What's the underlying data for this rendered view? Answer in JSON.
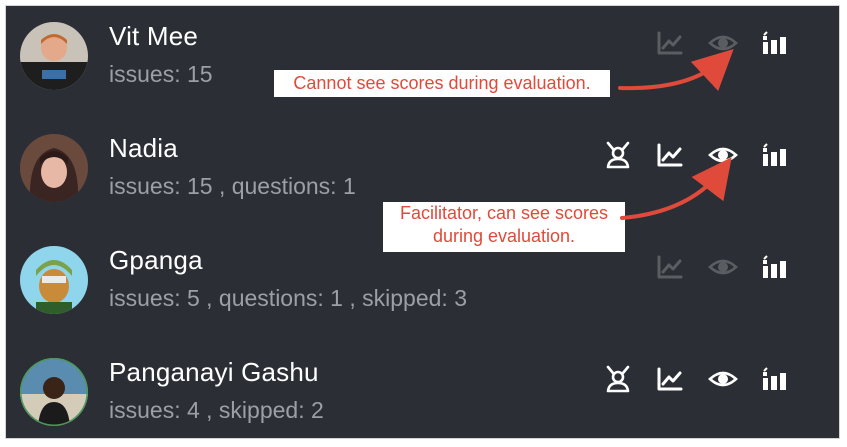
{
  "participants": [
    {
      "name": "Vit Mee",
      "stats": "issues: 15",
      "facilitator_icon": "none",
      "trend_icon": "faded",
      "eye_icon": "faded",
      "bars_icon": "active"
    },
    {
      "name": "Nadia",
      "stats": "issues: 15 , questions: 1",
      "facilitator_icon": "active",
      "trend_icon": "active",
      "eye_icon": "active",
      "bars_icon": "active"
    },
    {
      "name": "Gpanga",
      "stats": "issues: 5 , questions: 1 , skipped: 3",
      "facilitator_icon": "none",
      "trend_icon": "faded",
      "eye_icon": "faded",
      "bars_icon": "active"
    },
    {
      "name": "Panganayi Gashu",
      "stats": "issues: 4 , skipped: 2",
      "facilitator_icon": "active",
      "trend_icon": "active",
      "eye_icon": "active",
      "bars_icon": "active"
    }
  ],
  "annotations": [
    {
      "text": "Cannot see scores during evaluation."
    },
    {
      "line1": "Facilitator, can see scores",
      "line2": "during evaluation."
    }
  ],
  "icons": {
    "facilitator": "facilitator-icon",
    "trend": "trend-line-icon",
    "eye": "eye-icon",
    "bars": "bar-chart-icon"
  },
  "colors": {
    "background": "#2b2f35",
    "name_text": "#ffffff",
    "stats_text": "#9aa0a6",
    "annotation_text": "#e04a3a",
    "arrow": "#e04a3a"
  }
}
